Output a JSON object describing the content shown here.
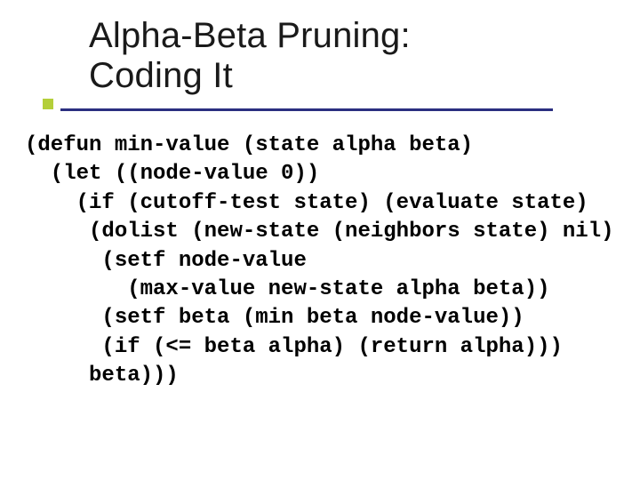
{
  "title_line1": "Alpha-Beta Pruning:",
  "title_line2": "Coding It",
  "code": "(defun min-value (state alpha beta)\n  (let ((node-value 0))\n    (if (cutoff-test state) (evaluate state)\n     (dolist (new-state (neighbors state) nil)\n      (setf node-value\n        (max-value new-state alpha beta))\n      (setf beta (min beta node-value))\n      (if (<= beta alpha) (return alpha)))\n     beta)))"
}
